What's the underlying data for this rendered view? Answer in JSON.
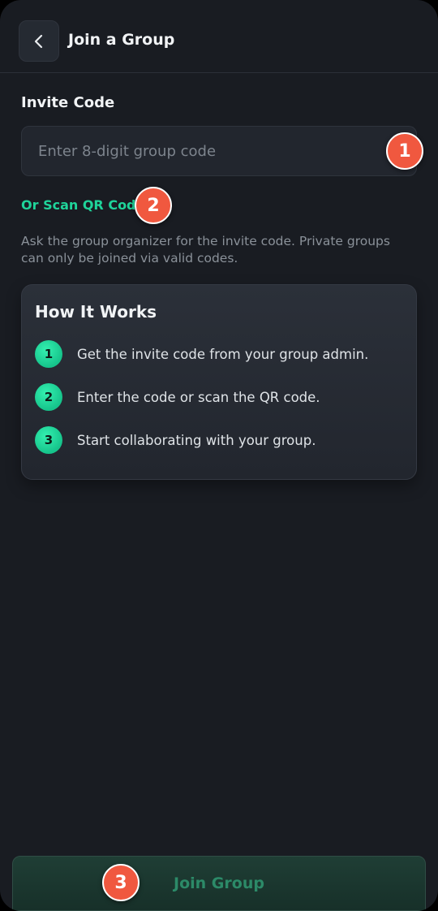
{
  "header": {
    "back_icon": "chevron-left-icon",
    "title": "Join a Group"
  },
  "form": {
    "label": "Invite Code",
    "placeholder": "Enter 8-digit group code",
    "value": "",
    "scan_link": "Or Scan QR Code",
    "help_text": "Ask the group organizer for the invite code. Private groups can only be joined via valid codes."
  },
  "how_it_works": {
    "title": "How It Works",
    "steps": [
      {
        "number": "1",
        "text": "Get the invite code from your group admin."
      },
      {
        "number": "2",
        "text": "Enter the code or scan the QR code."
      },
      {
        "number": "3",
        "text": "Start collaborating with your group."
      }
    ]
  },
  "footer": {
    "join_label": "Join Group"
  },
  "markers": [
    "1",
    "2",
    "3"
  ],
  "colors": {
    "background": "#191c22",
    "accent": "#1fd49a",
    "marker": "#f0583f",
    "join_button_bg": "#1f3e35",
    "join_button_text": "#2c8a68"
  }
}
